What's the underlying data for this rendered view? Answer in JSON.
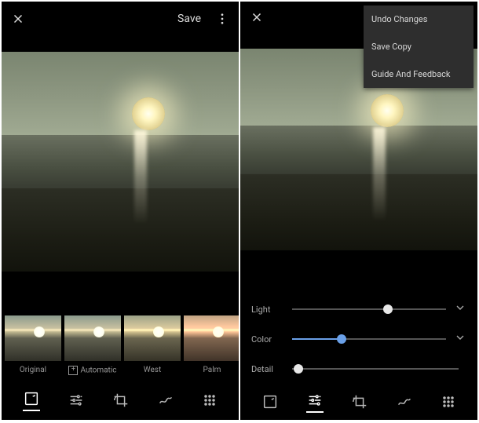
{
  "left": {
    "save_label": "Save",
    "thumbs": [
      {
        "label": "Original"
      },
      {
        "label": "Automatic"
      },
      {
        "label": "West"
      },
      {
        "label": "Palm"
      }
    ]
  },
  "right": {
    "menu": {
      "undo": "Undo Changes",
      "save_copy": "Save Copy",
      "guide": "Guide And Feedback"
    },
    "sliders": {
      "light": {
        "label": "Light",
        "value": 62
      },
      "color": {
        "label": "Color",
        "value": 32
      },
      "detail": {
        "label": "Detail",
        "value": 4
      }
    }
  }
}
